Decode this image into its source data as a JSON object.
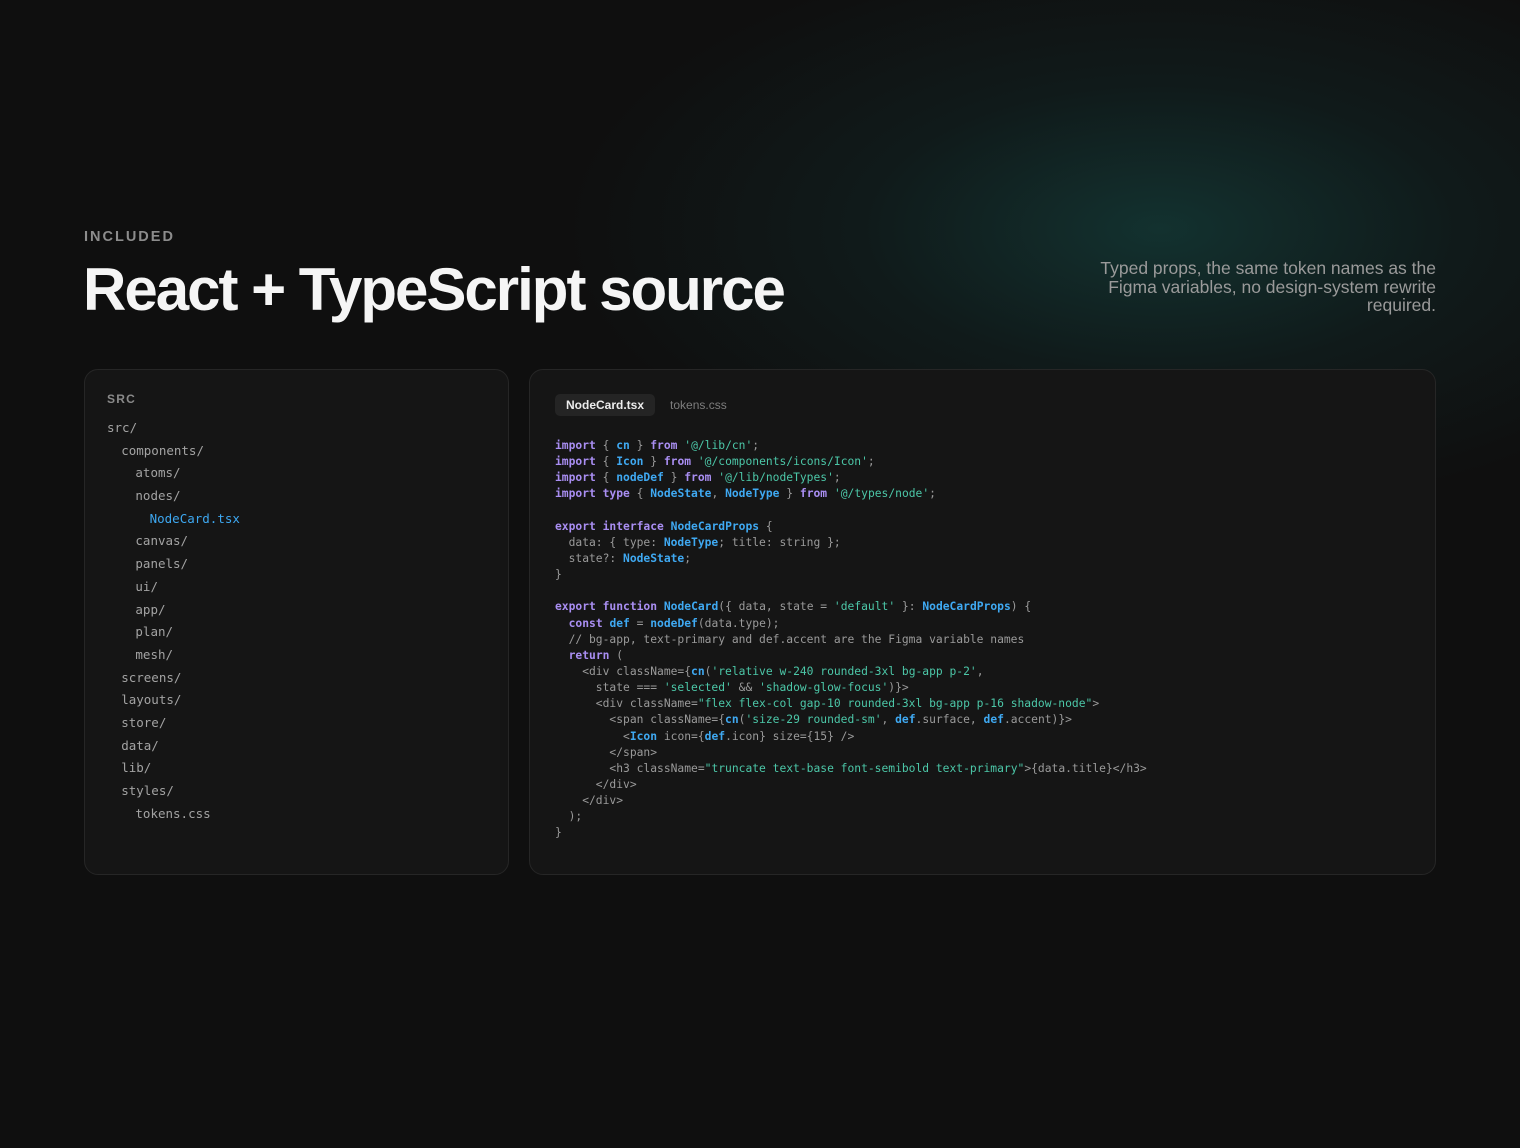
{
  "header": {
    "eyebrow": "INCLUDED",
    "title": "React + TypeScript source",
    "tagline": "Typed props, the same token names as the Figma variables, no design-system rewrite required."
  },
  "file_tree": {
    "heading": "SRC",
    "items": [
      {
        "label": "src/",
        "depth": 0,
        "active": false
      },
      {
        "label": "components/",
        "depth": 1,
        "active": false
      },
      {
        "label": "atoms/",
        "depth": 2,
        "active": false
      },
      {
        "label": "nodes/",
        "depth": 2,
        "active": false
      },
      {
        "label": "NodeCard.tsx",
        "depth": 3,
        "active": true
      },
      {
        "label": "canvas/",
        "depth": 2,
        "active": false
      },
      {
        "label": "panels/",
        "depth": 2,
        "active": false
      },
      {
        "label": "ui/",
        "depth": 2,
        "active": false
      },
      {
        "label": "app/",
        "depth": 2,
        "active": false
      },
      {
        "label": "plan/",
        "depth": 2,
        "active": false
      },
      {
        "label": "mesh/",
        "depth": 2,
        "active": false
      },
      {
        "label": "screens/",
        "depth": 1,
        "active": false
      },
      {
        "label": "layouts/",
        "depth": 1,
        "active": false
      },
      {
        "label": "store/",
        "depth": 1,
        "active": false
      },
      {
        "label": "data/",
        "depth": 1,
        "active": false
      },
      {
        "label": "lib/",
        "depth": 1,
        "active": false
      },
      {
        "label": "styles/",
        "depth": 1,
        "active": false
      },
      {
        "label": "tokens.css",
        "depth": 2,
        "active": false
      }
    ]
  },
  "editor": {
    "tabs": [
      {
        "label": "NodeCard.tsx",
        "active": true
      },
      {
        "label": "tokens.css",
        "active": false
      }
    ],
    "code_lines": [
      [
        [
          "k",
          "import"
        ],
        [
          "p",
          " { "
        ],
        [
          "t",
          "cn"
        ],
        [
          "p",
          " } "
        ],
        [
          "k",
          "from"
        ],
        [
          "p",
          " "
        ],
        [
          "s",
          "'@/lib/cn'"
        ],
        [
          "p",
          ";"
        ]
      ],
      [
        [
          "k",
          "import"
        ],
        [
          "p",
          " { "
        ],
        [
          "t",
          "Icon"
        ],
        [
          "p",
          " } "
        ],
        [
          "k",
          "from"
        ],
        [
          "p",
          " "
        ],
        [
          "s",
          "'@/components/icons/Icon'"
        ],
        [
          "p",
          ";"
        ]
      ],
      [
        [
          "k",
          "import"
        ],
        [
          "p",
          " { "
        ],
        [
          "t",
          "nodeDef"
        ],
        [
          "p",
          " } "
        ],
        [
          "k",
          "from"
        ],
        [
          "p",
          " "
        ],
        [
          "s",
          "'@/lib/nodeTypes'"
        ],
        [
          "p",
          ";"
        ]
      ],
      [
        [
          "k",
          "import"
        ],
        [
          "p",
          " "
        ],
        [
          "k",
          "type"
        ],
        [
          "p",
          " { "
        ],
        [
          "t",
          "NodeState"
        ],
        [
          "p",
          ", "
        ],
        [
          "t",
          "NodeType"
        ],
        [
          "p",
          " } "
        ],
        [
          "k",
          "from"
        ],
        [
          "p",
          " "
        ],
        [
          "s",
          "'@/types/node'"
        ],
        [
          "p",
          ";"
        ]
      ],
      [],
      [
        [
          "k",
          "export"
        ],
        [
          "p",
          " "
        ],
        [
          "k",
          "interface"
        ],
        [
          "p",
          " "
        ],
        [
          "t",
          "NodeCardProps"
        ],
        [
          "p",
          " {"
        ]
      ],
      [
        [
          "p",
          "  data: { type: "
        ],
        [
          "t",
          "NodeType"
        ],
        [
          "p",
          "; title: string };"
        ]
      ],
      [
        [
          "p",
          "  state?: "
        ],
        [
          "t",
          "NodeState"
        ],
        [
          "p",
          ";"
        ]
      ],
      [
        [
          "p",
          "}"
        ]
      ],
      [],
      [
        [
          "k",
          "export"
        ],
        [
          "p",
          " "
        ],
        [
          "k",
          "function"
        ],
        [
          "p",
          " "
        ],
        [
          "t",
          "NodeCard"
        ],
        [
          "p",
          "({ data, state = "
        ],
        [
          "s",
          "'default'"
        ],
        [
          "p",
          " }: "
        ],
        [
          "t",
          "NodeCardProps"
        ],
        [
          "p",
          ") {"
        ]
      ],
      [
        [
          "p",
          "  "
        ],
        [
          "k",
          "const"
        ],
        [
          "p",
          " "
        ],
        [
          "t",
          "def"
        ],
        [
          "p",
          " = "
        ],
        [
          "t",
          "nodeDef"
        ],
        [
          "p",
          "(data.type);"
        ]
      ],
      [
        [
          "p",
          "  // bg-app, text-primary and def.accent are the Figma variable names"
        ]
      ],
      [
        [
          "p",
          "  "
        ],
        [
          "k",
          "return"
        ],
        [
          "p",
          " ("
        ]
      ],
      [
        [
          "p",
          "    <div className={"
        ],
        [
          "t",
          "cn"
        ],
        [
          "p",
          "("
        ],
        [
          "s",
          "'relative w-240 rounded-3xl bg-app p-2'"
        ],
        [
          "p",
          ","
        ]
      ],
      [
        [
          "p",
          "      state === "
        ],
        [
          "s",
          "'selected'"
        ],
        [
          "p",
          " && "
        ],
        [
          "s",
          "'shadow-glow-focus'"
        ],
        [
          "p",
          ")}>"
        ]
      ],
      [
        [
          "p",
          "      <div className="
        ],
        [
          "s",
          "\"flex flex-col gap-10 rounded-3xl bg-app p-16 shadow-node\""
        ],
        [
          "p",
          ">"
        ]
      ],
      [
        [
          "p",
          "        <span className={"
        ],
        [
          "t",
          "cn"
        ],
        [
          "p",
          "("
        ],
        [
          "s",
          "'size-29 rounded-sm'"
        ],
        [
          "p",
          ", "
        ],
        [
          "t",
          "def"
        ],
        [
          "p",
          ".surface, "
        ],
        [
          "t",
          "def"
        ],
        [
          "p",
          ".accent)}>"
        ]
      ],
      [
        [
          "p",
          "          <"
        ],
        [
          "t",
          "Icon"
        ],
        [
          "p",
          " icon={"
        ],
        [
          "t",
          "def"
        ],
        [
          "p",
          ".icon} size={15} />"
        ]
      ],
      [
        [
          "p",
          "        </span>"
        ]
      ],
      [
        [
          "p",
          "        <h3 className="
        ],
        [
          "s",
          "\"truncate text-base font-semibold text-primary\""
        ],
        [
          "p",
          ">{data.title}</h3>"
        ]
      ],
      [
        [
          "p",
          "      </div>"
        ]
      ],
      [
        [
          "p",
          "    </div>"
        ]
      ],
      [
        [
          "p",
          "  );"
        ]
      ],
      [
        [
          "p",
          "}"
        ]
      ]
    ]
  }
}
